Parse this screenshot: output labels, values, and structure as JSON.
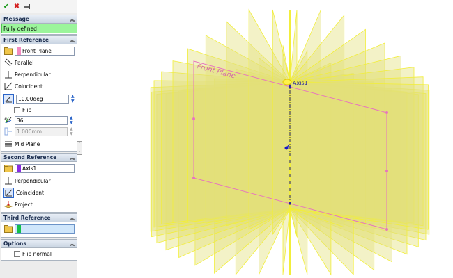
{
  "toolbar": {
    "ok_icon": "check-icon",
    "cancel_icon": "x-icon",
    "pushpin_icon": "pushpin-icon",
    "ok_color": "#1a9a1a",
    "cancel_color": "#d42020"
  },
  "message": {
    "header": "Message",
    "status": "Fully defined",
    "status_color": "#9bf59b"
  },
  "first_reference": {
    "header": "First Reference",
    "selection": "Front Plane",
    "selection_color": "#f28ac0",
    "parallel": "Parallel",
    "perpendicular": "Perpendicular",
    "coincident": "Coincident",
    "angle": "10.00deg",
    "flip": "Flip",
    "count": "36",
    "distance": "1.000mm",
    "mid_plane": "Mid Plane"
  },
  "second_reference": {
    "header": "Second Reference",
    "selection": "Axis1",
    "selection_color": "#8a2be2",
    "perpendicular": "Perpendicular",
    "coincident": "Coincident",
    "project": "Project"
  },
  "third_reference": {
    "header": "Third Reference",
    "selection": "",
    "selection_color": "#13c04a"
  },
  "options": {
    "header": "Options",
    "flip_normal": "Flip normal"
  },
  "viewport": {
    "front_plane_label": "Front Plane",
    "axis_label": "Axis1",
    "plane_count": 36,
    "plane_fill": "#e2e07a",
    "plane_edge": "#f2ee3a",
    "preview_edge": "#e776bd"
  }
}
